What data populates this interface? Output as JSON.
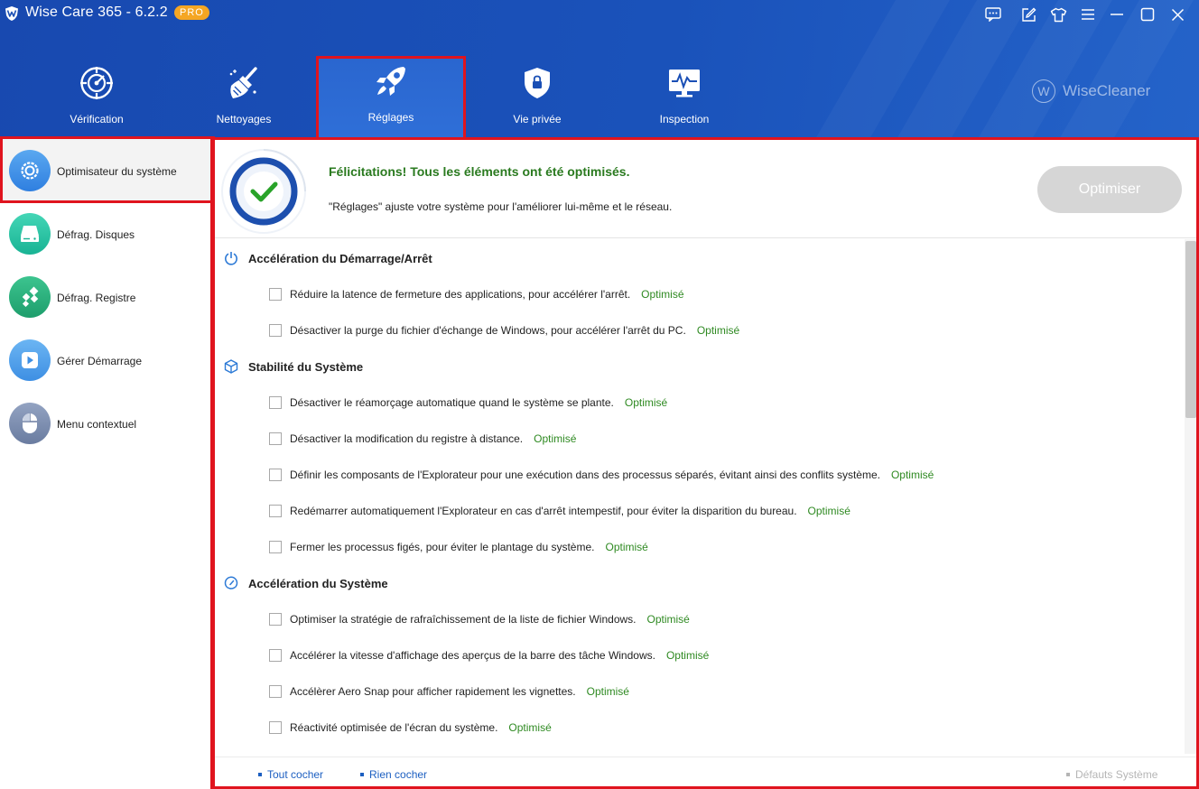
{
  "app": {
    "title": "Wise Care 365 - 6.2.2",
    "badge": "PRO",
    "brand": "WiseCleaner",
    "brand_initial": "W",
    "colors": {
      "header": "#1a4fb5",
      "accent_red": "#e0141e",
      "success": "#2a7a1f",
      "link": "#1c5fc1"
    }
  },
  "window_controls": [
    "feedback-icon",
    "edit-icon",
    "skin-icon",
    "menu-icon",
    "minimize-icon",
    "maximize-icon",
    "close-icon"
  ],
  "tabs": [
    {
      "label": "Vérification",
      "icon": "radar-icon",
      "active": false
    },
    {
      "label": "Nettoyages",
      "icon": "broom-icon",
      "active": false
    },
    {
      "label": "Réglages",
      "icon": "rocket-icon",
      "active": true
    },
    {
      "label": "Vie privée",
      "icon": "shield-lock-icon",
      "active": false
    },
    {
      "label": "Inspection",
      "icon": "monitor-pulse-icon",
      "active": false
    }
  ],
  "sidebar": {
    "items": [
      {
        "label": "Optimisateur du système",
        "icon": "gear-icon",
        "active": true
      },
      {
        "label": "Défrag. Disques",
        "icon": "disk-icon",
        "active": false
      },
      {
        "label": "Défrag. Registre",
        "icon": "registry-icon",
        "active": false
      },
      {
        "label": "Gérer Démarrage",
        "icon": "play-icon",
        "active": false
      },
      {
        "label": "Menu contextuel",
        "icon": "mouse-icon",
        "active": false
      }
    ]
  },
  "banner": {
    "title": "Félicitations! Tous les éléments ont été optimisés.",
    "subtitle": "\"Réglages\" ajuste votre système pour l'améliorer lui-même et le réseau.",
    "button": "Optimiser",
    "status_icon": "check-icon"
  },
  "sections": [
    {
      "title": "Accélération du Démarrage/Arrêt",
      "icon": "power-icon",
      "items": [
        {
          "label": "Réduire la latence de fermeture des applications, pour accélérer l'arrêt.",
          "status": "Optimisé",
          "checked": false
        },
        {
          "label": "Désactiver la purge du fichier d'échange de Windows, pour accélérer l'arrêt du PC.",
          "status": "Optimisé",
          "checked": false
        }
      ]
    },
    {
      "title": "Stabilité du Système",
      "icon": "cube-icon",
      "items": [
        {
          "label": "Désactiver le réamorçage automatique quand le système se plante.",
          "status": "Optimisé",
          "checked": false
        },
        {
          "label": "Désactiver la modification du registre à distance.",
          "status": "Optimisé",
          "checked": false
        },
        {
          "label": "Définir les composants de l'Explorateur pour une exécution dans des processus séparés, évitant ainsi des conflits système.",
          "status": "Optimisé",
          "checked": false
        },
        {
          "label": "Redémarrer automatiquement l'Explorateur en cas d'arrêt intempestif, pour éviter la disparition du bureau.",
          "status": "Optimisé",
          "checked": false
        },
        {
          "label": "Fermer les processus figés, pour éviter le plantage du système.",
          "status": "Optimisé",
          "checked": false
        }
      ]
    },
    {
      "title": "Accélération du Système",
      "icon": "speedometer-icon",
      "items": [
        {
          "label": "Optimiser la stratégie de rafraîchissement de la liste de fichier Windows.",
          "status": "Optimisé",
          "checked": false
        },
        {
          "label": "Accélérer la vitesse d'affichage des aperçus de la barre des tâche Windows.",
          "status": "Optimisé",
          "checked": false
        },
        {
          "label": "Accélèrer Aero Snap pour afficher rapidement les vignettes.",
          "status": "Optimisé",
          "checked": false
        },
        {
          "label": "Réactivité optimisée de l'écran du système.",
          "status": "Optimisé",
          "checked": false
        }
      ]
    }
  ],
  "footer": {
    "check_all": "Tout cocher",
    "check_none": "Rien cocher",
    "defaults": "Défauts Système"
  }
}
